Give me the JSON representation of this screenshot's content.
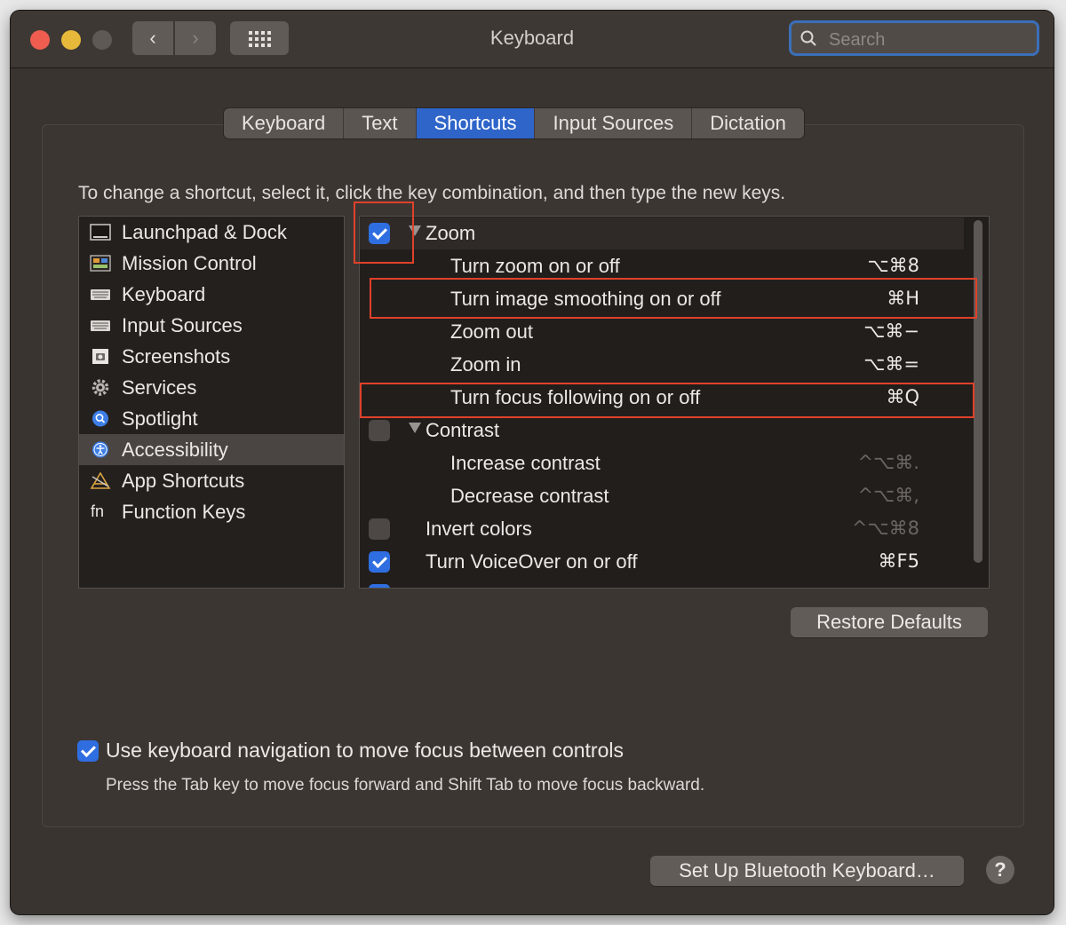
{
  "window": {
    "title": "Keyboard",
    "search_placeholder": "Search"
  },
  "tabs": [
    {
      "label": "Keyboard",
      "active": false
    },
    {
      "label": "Text",
      "active": false
    },
    {
      "label": "Shortcuts",
      "active": true
    },
    {
      "label": "Input Sources",
      "active": false
    },
    {
      "label": "Dictation",
      "active": false
    }
  ],
  "instructions": "To change a shortcut, select it, click the key combination, and then type the new keys.",
  "sidebar": {
    "selected": "Accessibility",
    "items": [
      {
        "label": "Launchpad & Dock",
        "icon": "launchpad-dock-icon"
      },
      {
        "label": "Mission Control",
        "icon": "mission-control-icon"
      },
      {
        "label": "Keyboard",
        "icon": "keyboard-icon"
      },
      {
        "label": "Input Sources",
        "icon": "input-sources-icon"
      },
      {
        "label": "Screenshots",
        "icon": "screenshots-icon"
      },
      {
        "label": "Services",
        "icon": "gear-icon"
      },
      {
        "label": "Spotlight",
        "icon": "spotlight-icon"
      },
      {
        "label": "Accessibility",
        "icon": "accessibility-icon"
      },
      {
        "label": "App Shortcuts",
        "icon": "app-shortcuts-icon"
      },
      {
        "label": "Function Keys",
        "icon": "fn-icon",
        "icon_text": "fn"
      }
    ]
  },
  "shortcuts": [
    {
      "label": "Zoom",
      "checked": true,
      "group": true,
      "expanded": true,
      "keys": ""
    },
    {
      "label": "Turn zoom on or off",
      "keys": "⌥⌘8"
    },
    {
      "label": "Turn image smoothing on or off",
      "keys": "⌘H"
    },
    {
      "label": "Zoom out",
      "keys": "⌥⌘−"
    },
    {
      "label": "Zoom in",
      "keys": "⌥⌘="
    },
    {
      "label": "Turn focus following on or off",
      "keys": "⌘Q"
    },
    {
      "label": "Contrast",
      "checked": false,
      "group": true,
      "expanded": true,
      "keys": ""
    },
    {
      "label": "Increase contrast",
      "keys": "^⌥⌘.",
      "disabled": true
    },
    {
      "label": "Decrease contrast",
      "keys": "^⌥⌘,",
      "disabled": true
    },
    {
      "label": "Invert colors",
      "checked": false,
      "keys": "^⌥⌘8",
      "disabled": true
    },
    {
      "label": "Turn VoiceOver on or off",
      "checked": true,
      "keys": "⌘F5"
    }
  ],
  "buttons": {
    "restore_defaults": "Restore Defaults",
    "setup_bluetooth": "Set Up Bluetooth Keyboard…",
    "help": "?"
  },
  "keyboard_navigation": {
    "checked": true,
    "label": "Use keyboard navigation to move focus between controls",
    "description": "Press the Tab key to move focus forward and Shift Tab to move focus backward."
  },
  "colors": {
    "accent": "#2f65c9",
    "highlight": "#e0412a"
  }
}
